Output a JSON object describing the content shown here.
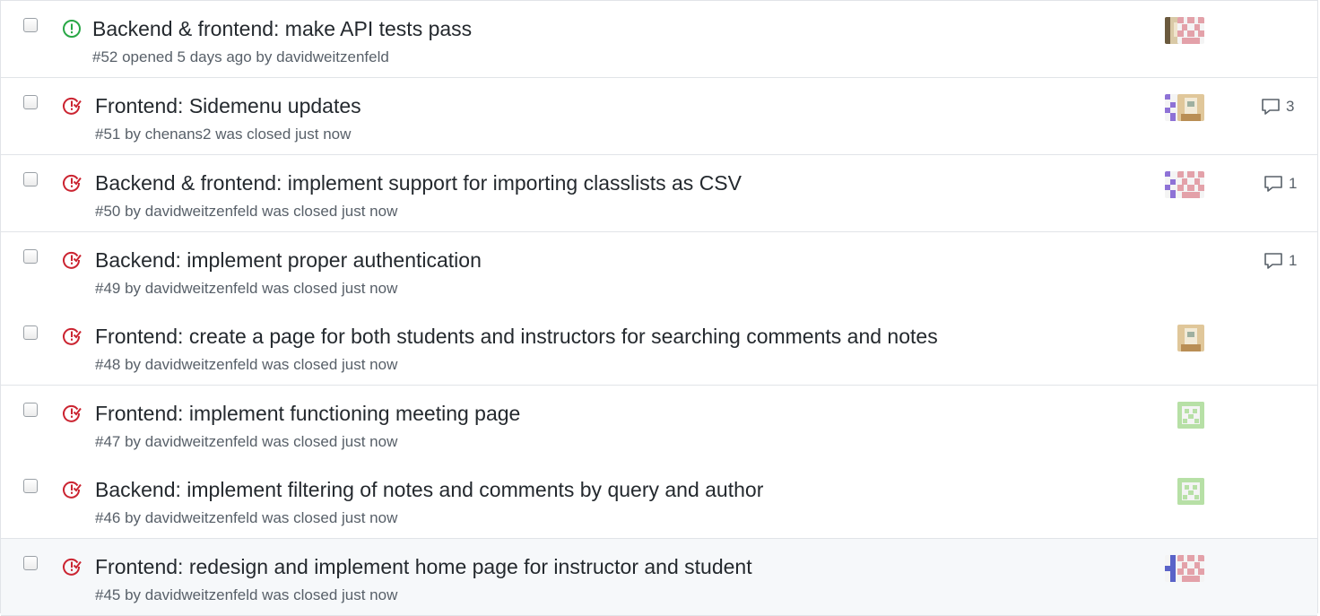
{
  "issues": [
    {
      "state": "open",
      "title": "Backend & frontend: make API tests pass",
      "meta": "#52 opened 5 days ago by davidweitzenfeld",
      "avatars": [
        "photo",
        "pink"
      ],
      "comments": ""
    },
    {
      "state": "closed",
      "title": "Frontend: Sidemenu updates",
      "meta": "#51 by chenans2 was closed just now",
      "avatars": [
        "purple",
        "photo"
      ],
      "comments": "3"
    },
    {
      "state": "closed",
      "title": "Backend & frontend: implement support for importing classlists as CSV",
      "meta": "#50 by davidweitzenfeld was closed just now",
      "avatars": [
        "purple",
        "pink"
      ],
      "comments": "1"
    },
    {
      "state": "closed",
      "title": "Backend: implement proper authentication",
      "meta": "#49 by davidweitzenfeld was closed just now",
      "avatars": [],
      "comments": "1"
    },
    {
      "state": "closed",
      "title": "Frontend: create a page for both students and instructors for searching comments and notes",
      "meta": "#48 by davidweitzenfeld was closed just now",
      "avatars": [
        "photo"
      ],
      "comments": ""
    },
    {
      "state": "closed",
      "title": "Frontend: implement functioning meeting page",
      "meta": "#47 by davidweitzenfeld was closed just now",
      "avatars": [
        "green"
      ],
      "comments": ""
    },
    {
      "state": "closed",
      "title": "Backend: implement filtering of notes and comments by query and author",
      "meta": "#46 by davidweitzenfeld was closed just now",
      "avatars": [
        "green"
      ],
      "comments": ""
    },
    {
      "state": "closed",
      "title": "Frontend: redesign and implement home page for instructor and student",
      "meta": "#45 by davidweitzenfeld was closed just now",
      "avatars": [
        "blue",
        "pink"
      ],
      "comments": ""
    }
  ],
  "icons": {
    "open": "issue-opened-icon",
    "closed": "issue-closed-icon",
    "comment": "comment-icon"
  },
  "colors": {
    "open": "#28a745",
    "closed": "#cb2431",
    "border": "#e1e4e8",
    "meta": "#586069",
    "hover_row": "#f6f8fa"
  }
}
